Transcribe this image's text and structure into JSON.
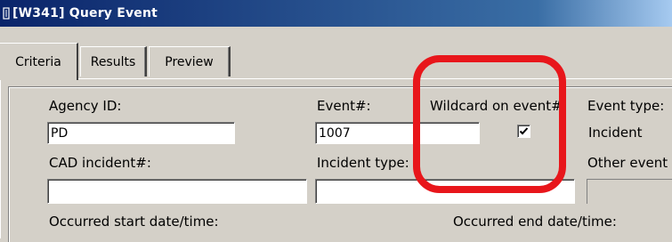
{
  "window": {
    "title": "[W341] Query Event",
    "icon": "app-icon"
  },
  "tabs": [
    {
      "label": "Criteria",
      "active": true
    },
    {
      "label": "Results",
      "active": false
    },
    {
      "label": "Preview",
      "active": false
    }
  ],
  "form": {
    "agency_id": {
      "label": "Agency ID:",
      "value": "PD"
    },
    "event_num": {
      "label": "Event#:",
      "value": "1007"
    },
    "wildcard": {
      "label": "Wildcard on event#:",
      "checked": true
    },
    "event_type": {
      "label": "Event type:",
      "value": "Incident"
    },
    "cad_incident": {
      "label": "CAD incident#:",
      "value": ""
    },
    "incident_type": {
      "label": "Incident type:",
      "value": ""
    },
    "other_event": {
      "label": "Other event",
      "value": ""
    },
    "occurred_start": {
      "label": "Occurred start date/time:"
    },
    "occurred_end": {
      "label": "Occurred end date/time:"
    }
  },
  "annotation": {
    "color": "#e8161b",
    "shape": "rounded-rectangle"
  }
}
